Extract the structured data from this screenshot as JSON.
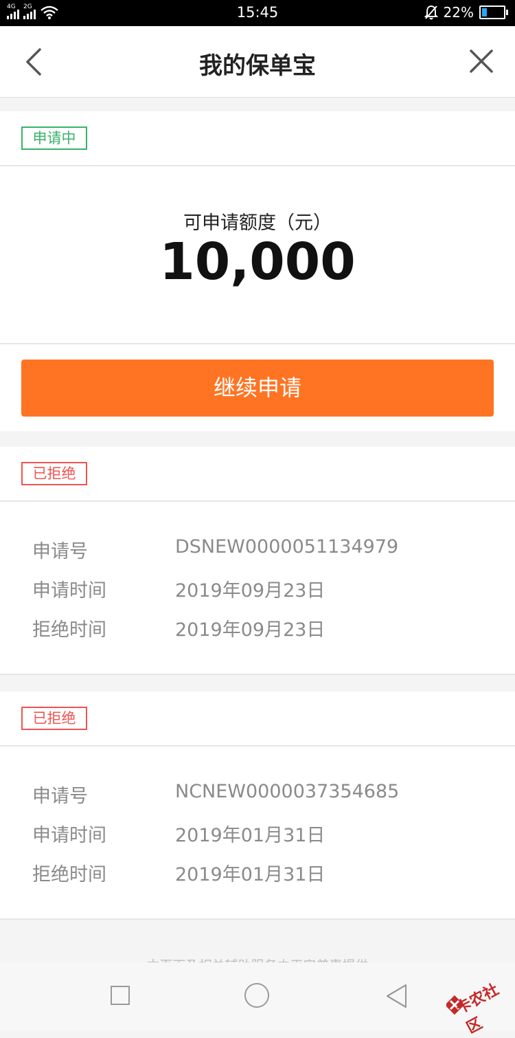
{
  "status_bar": {
    "network1": "4G",
    "network2": "2G",
    "time": "15:45",
    "battery": "22%",
    "battery_level": 0.22
  },
  "nav": {
    "title": "我的保单宝",
    "back_icon": "chevron-left-icon",
    "close_icon": "close-icon"
  },
  "colors": {
    "accent": "#ff7422",
    "status_pending": "#39b26b",
    "status_rejected": "#ef5350"
  },
  "pending": {
    "status": "申请中",
    "quota_label": "可申请额度（元）",
    "quota_value": "10,000",
    "button_label": "继续申请"
  },
  "rejected": [
    {
      "status": "已拒绝",
      "rows": [
        {
          "label": "申请号",
          "value": "DSNEW0000051134979"
        },
        {
          "label": "申请时间",
          "value": "2019年09月23日"
        },
        {
          "label": "拒绝时间",
          "value": "2019年09月23日"
        }
      ]
    },
    {
      "status": "已拒绝",
      "rows": [
        {
          "label": "申请号",
          "value": "NCNEW0000037354685"
        },
        {
          "label": "申请时间",
          "value": "2019年01月31日"
        },
        {
          "label": "拒绝时间",
          "value": "2019年01月31日"
        }
      ]
    }
  ],
  "footer": {
    "text": "本页面及相关辅助服务由平安普惠提供"
  },
  "watermark": {
    "text": "卡农社区"
  }
}
